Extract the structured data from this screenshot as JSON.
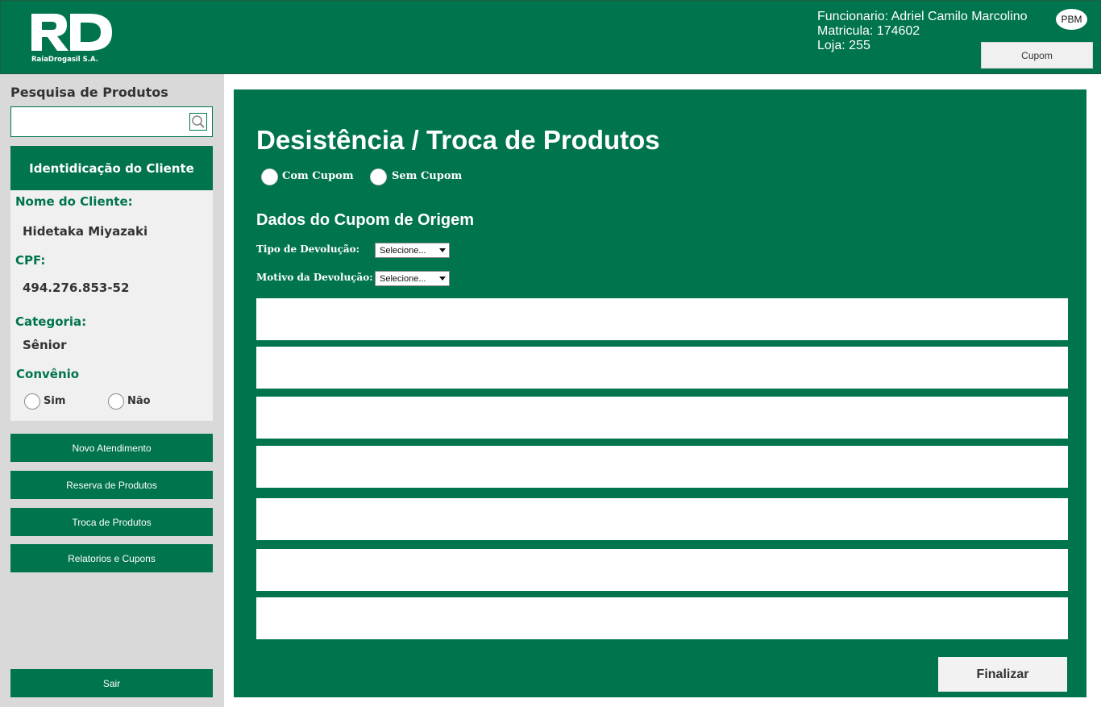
{
  "header": {
    "logo_text": "RaiaDrogasil S.A.",
    "employee": "Funcionario: Adriel Camilo Marcolino",
    "matricula": "Matricula: 174602",
    "loja": "Loja: 255",
    "pbm_label": "PBM",
    "cupom_label": "Cupom"
  },
  "sidebar": {
    "search_title": "Pesquisa de Produtos",
    "search_value": "",
    "client_header": "Identidicação do Cliente",
    "name_label": "Nome do Cliente:",
    "name_value": "Hidetaka Miyazaki",
    "cpf_label": "CPF:",
    "cpf_value": "494.276.853-52",
    "category_label": "Categoria:",
    "category_value": "Sênior",
    "convenio_label": "Convênio",
    "convenio_yes": "Sim",
    "convenio_no": "Não",
    "buttons": [
      "Novo Atendimento",
      "Reserva de Produtos",
      "Troca de Produtos",
      "Relatorios e Cupons"
    ],
    "logout_label": "Sair"
  },
  "main": {
    "title": "Desistência / Troca de Produtos",
    "radio_with": "Com Cupom",
    "radio_without": "Sem Cupom",
    "section_title": "Dados do Cupom de Origem",
    "return_type_label": "Tipo de Devolução:",
    "return_type_value": "Selecione...",
    "return_reason_label": "Motivo da Devolução:",
    "return_reason_value": "Selecione...",
    "finalize_label": "Finalizar"
  }
}
